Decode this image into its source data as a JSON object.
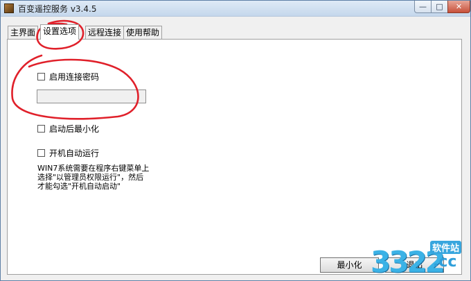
{
  "window": {
    "title": "百变遥控服务 v3.4.5",
    "controls": {
      "minimize": "—",
      "maximize": "□",
      "close": "✕"
    }
  },
  "tabs": [
    {
      "label": "主界面",
      "active": false
    },
    {
      "label": "设置选项",
      "active": true
    },
    {
      "label": "远程连接",
      "active": false
    },
    {
      "label": "使用帮助",
      "active": false
    }
  ],
  "settings": {
    "enable_password": {
      "label": "启用连接密码",
      "checked": false
    },
    "password_value": "",
    "start_minimized": {
      "label": "启动后最小化",
      "checked": false
    },
    "auto_start": {
      "label": "开机自动运行",
      "checked": false
    },
    "note_lines": [
      "WIN7系统需要在程序右键菜单上",
      "选择\"以管理员权限运行\"，然后",
      "才能勾选\"开机自动启动\""
    ]
  },
  "buttons": {
    "minimize": "最小化",
    "exit": "退出"
  },
  "watermark": {
    "number": "3322",
    "domain": ".cc",
    "site": "软件站"
  },
  "annotation_color": "#e0202a"
}
